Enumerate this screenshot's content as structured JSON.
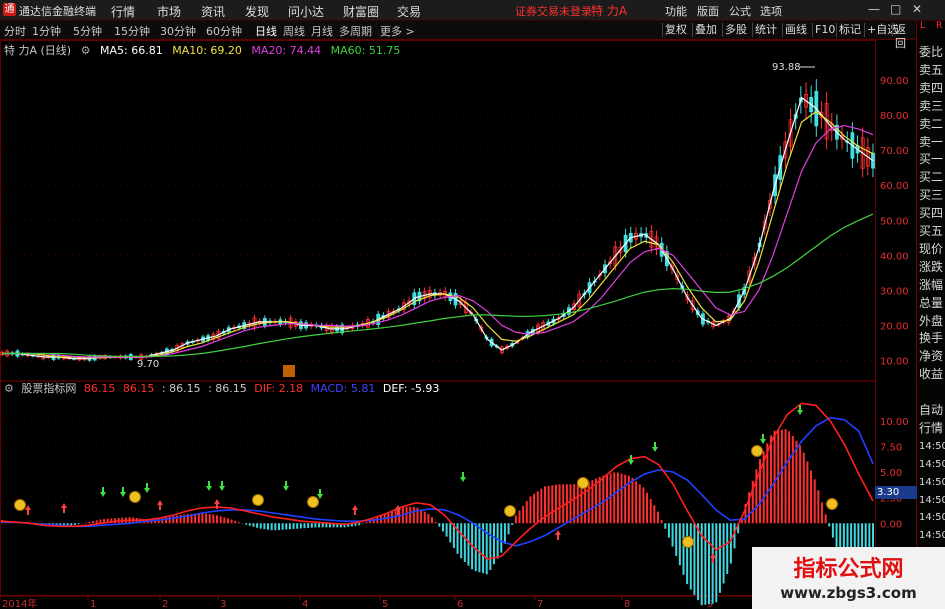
{
  "app": {
    "title": "通达信金融终端",
    "warning": "证券交易未登录",
    "stock": "特 力A"
  },
  "menu": [
    "行情",
    "市场",
    "资讯",
    "发现",
    "问小达",
    "财富圈",
    "交易"
  ],
  "right_menu": [
    "功能",
    "版面",
    "公式",
    "选项"
  ],
  "window_buttons": [
    "—",
    "□",
    "✕"
  ],
  "toolbar": {
    "periods": [
      "分时",
      "1分钟",
      "5分钟",
      "15分钟",
      "30分钟",
      "60分钟",
      "日线",
      "周线",
      "月线",
      "多周期",
      "更多 >"
    ],
    "active_period": "日线",
    "buttons": [
      "复权",
      "叠加",
      "多股",
      "统计",
      "画线",
      "F10",
      "标记",
      "+自选",
      "返回"
    ]
  },
  "right_panel": [
    "委比",
    "卖五",
    "卖四",
    "卖三",
    "卖二",
    "卖一",
    "买一",
    "买二",
    "买三",
    "买四",
    "买五",
    "现价",
    "涨跌",
    "涨幅",
    "总量",
    "外盘",
    "换手",
    "净资",
    "收益",
    "",
    "自动",
    "行情",
    "14:50",
    "14:50",
    "14:50",
    "14:50",
    "14:50",
    "14:50",
    "14:50",
    "14:50"
  ],
  "right_header": {
    "left": "L",
    "right": "R"
  },
  "main_indicator": {
    "name": "特 力A (日线)",
    "items": [
      {
        "label": "MA5: 66.81",
        "color": "#ffffff"
      },
      {
        "label": "MA10: 69.20",
        "color": "#f0e040"
      },
      {
        "label": "MA20: 74.44",
        "color": "#e040e0"
      },
      {
        "label": "MA60: 51.75",
        "color": "#40d040"
      }
    ]
  },
  "sub_indicator": {
    "name": "股票指标网",
    "items": [
      {
        "label": "86.15",
        "color": "#ff3030"
      },
      {
        "label": "86.15",
        "color": "#ff3030"
      },
      {
        "label": ": 86.15",
        "color": "#c8c8c8"
      },
      {
        "label": ": 86.15",
        "color": "#c8c8c8"
      },
      {
        "label": "DIF: 2.18",
        "color": "#ff3030"
      },
      {
        "label": "MACD: 5.81",
        "color": "#4040ff"
      },
      {
        "label": "DEF: -5.93",
        "color": "#ffffff"
      }
    ]
  },
  "annotations": {
    "high": "93.88",
    "low": "9.70",
    "sub_price": "3.30"
  },
  "chart_data": {
    "type": "line",
    "title": "特 力A (日线)",
    "price_axis": {
      "ticks": [
        "90.00",
        "80.00",
        "70.00",
        "60.00",
        "50.00",
        "40.00",
        "30.00",
        "20.00",
        "10.00"
      ],
      "ylim": [
        5,
        98
      ]
    },
    "sub_axis": {
      "ticks": [
        "10.00",
        "7.50",
        "5.00",
        "2.50",
        "0.00"
      ],
      "ylim": [
        -7,
        13
      ]
    },
    "x_labels": [
      "2014年",
      "1",
      "2",
      "3",
      "4",
      "5",
      "6",
      "7",
      "8",
      "9"
    ],
    "series": [
      {
        "name": "MA5",
        "color": "#ffffff",
        "values": [
          12,
          12,
          11.5,
          11,
          11,
          10.5,
          10.5,
          11,
          11,
          11,
          11,
          12,
          13,
          15,
          16,
          17,
          19,
          20,
          21,
          21,
          21,
          20,
          20,
          19,
          19,
          20,
          21,
          23,
          25,
          28,
          29,
          29,
          27,
          23,
          16,
          13,
          15,
          18,
          20,
          22,
          25,
          30,
          35,
          40,
          45,
          46,
          43,
          36,
          28,
          22,
          20,
          22,
          30,
          42,
          58,
          72,
          85,
          82,
          77,
          73,
          70,
          67
        ]
      },
      {
        "name": "MA10",
        "color": "#f0e040",
        "values": [
          12,
          12,
          12,
          11.5,
          11,
          11,
          10.8,
          10.8,
          11,
          11,
          11,
          11.5,
          12.5,
          14,
          15,
          16.5,
          18,
          19.5,
          20.5,
          21,
          21,
          20.5,
          20,
          19.5,
          19.5,
          20,
          21,
          22.5,
          24.5,
          27,
          28.5,
          29,
          28,
          25,
          20,
          16,
          15.5,
          17,
          19,
          21,
          23,
          27,
          32,
          37,
          42,
          44,
          43,
          38,
          31,
          25,
          21,
          21.5,
          27,
          38,
          52,
          66,
          78,
          81,
          78,
          74,
          71,
          69
        ]
      },
      {
        "name": "MA20",
        "color": "#e040e0",
        "values": [
          12,
          12,
          12,
          12,
          11.5,
          11.2,
          11,
          11,
          11,
          11,
          11,
          11.2,
          12,
          13,
          14,
          15.5,
          17,
          18.5,
          19.5,
          20,
          20.5,
          20.5,
          20,
          20,
          19.8,
          19.8,
          20.5,
          21.5,
          23,
          25,
          27,
          28,
          28.5,
          27,
          24,
          20,
          18,
          17.5,
          18,
          19.5,
          21,
          24,
          28,
          33,
          38,
          41,
          42,
          40,
          35,
          30,
          25,
          23,
          24,
          30,
          40,
          52,
          64,
          72,
          76,
          77,
          76,
          74.4
        ]
      },
      {
        "name": "MA60",
        "color": "#40d040",
        "values": [
          12,
          12,
          12,
          12,
          12,
          11.8,
          11.5,
          11.3,
          11.2,
          11.2,
          11.2,
          11.2,
          11.3,
          11.6,
          12,
          12.6,
          13.3,
          14,
          14.8,
          15.5,
          16.2,
          16.8,
          17.3,
          17.8,
          18.2,
          18.6,
          19,
          19.5,
          20,
          20.7,
          21.3,
          22,
          22.5,
          23,
          23,
          22.8,
          22.6,
          22.6,
          22.8,
          23.2,
          23.8,
          24.7,
          25.8,
          27,
          28.3,
          29.5,
          30.2,
          30.5,
          30.3,
          29.8,
          29.4,
          29.5,
          30.5,
          32,
          34,
          36.5,
          39.5,
          42.5,
          45.5,
          48,
          50,
          51.75
        ]
      }
    ],
    "macd": {
      "dif": [
        0.2,
        0.1,
        0,
        -0.2,
        -0.3,
        -0.3,
        -0.2,
        0,
        0.2,
        0.3,
        0.3,
        0.5,
        0.8,
        1.2,
        1.5,
        1.6,
        1.5,
        1.2,
        0.9,
        0.6,
        0.4,
        0.2,
        0.1,
        0,
        -0.1,
        0.1,
        0.5,
        1,
        1.6,
        2,
        1.8,
        0.8,
        -0.8,
        -2.3,
        -3.5,
        -3.2,
        -1.8,
        -0.5,
        0.6,
        1.5,
        2.3,
        3.2,
        4.3,
        5.5,
        6.3,
        6.5,
        5.7,
        3.8,
        1.2,
        -1.2,
        -2.6,
        -1.8,
        1.2,
        4.8,
        8.3,
        10.6,
        11.7,
        11.5,
        10,
        7.7,
        4.8,
        2.18
      ],
      "macd": [
        0.1,
        0.1,
        0,
        -0.1,
        -0.2,
        -0.3,
        -0.3,
        -0.2,
        -0.1,
        0,
        0.2,
        0.3,
        0.5,
        0.7,
        1,
        1.2,
        1.3,
        1.3,
        1.2,
        1,
        0.8,
        0.6,
        0.4,
        0.3,
        0.2,
        0.2,
        0.3,
        0.5,
        0.8,
        1.2,
        1.4,
        1.3,
        0.8,
        0,
        -1,
        -1.8,
        -2.2,
        -1.8,
        -1.2,
        -0.4,
        0.4,
        1.2,
        2,
        3,
        4,
        4.8,
        5.2,
        5,
        4.2,
        2.8,
        1.3,
        0.3,
        0.4,
        1.8,
        3.8,
        6,
        8,
        9.5,
        10.3,
        10.1,
        9,
        5.81
      ],
      "hist": [
        0.3,
        0.1,
        -0.1,
        -0.3,
        -0.3,
        -0.2,
        0.1,
        0.4,
        0.5,
        0.6,
        0.4,
        0.5,
        0.7,
        0.9,
        1,
        0.8,
        0.4,
        -0.1,
        -0.5,
        -0.7,
        -0.6,
        -0.5,
        -0.4,
        -0.4,
        -0.4,
        -0.2,
        0.4,
        1,
        1.6,
        1.6,
        0.8,
        -1,
        -3.2,
        -4.6,
        -5,
        -2.8,
        0.8,
        2.6,
        3.6,
        3.8,
        3.8,
        4,
        4.6,
        5,
        4.6,
        3.4,
        1,
        -2.4,
        -6,
        -8,
        -7.8,
        -4.2,
        1.6,
        6,
        9,
        9.2,
        7.4,
        4,
        -0.6,
        -4.8,
        -8.4,
        -7.3
      ]
    }
  }
}
